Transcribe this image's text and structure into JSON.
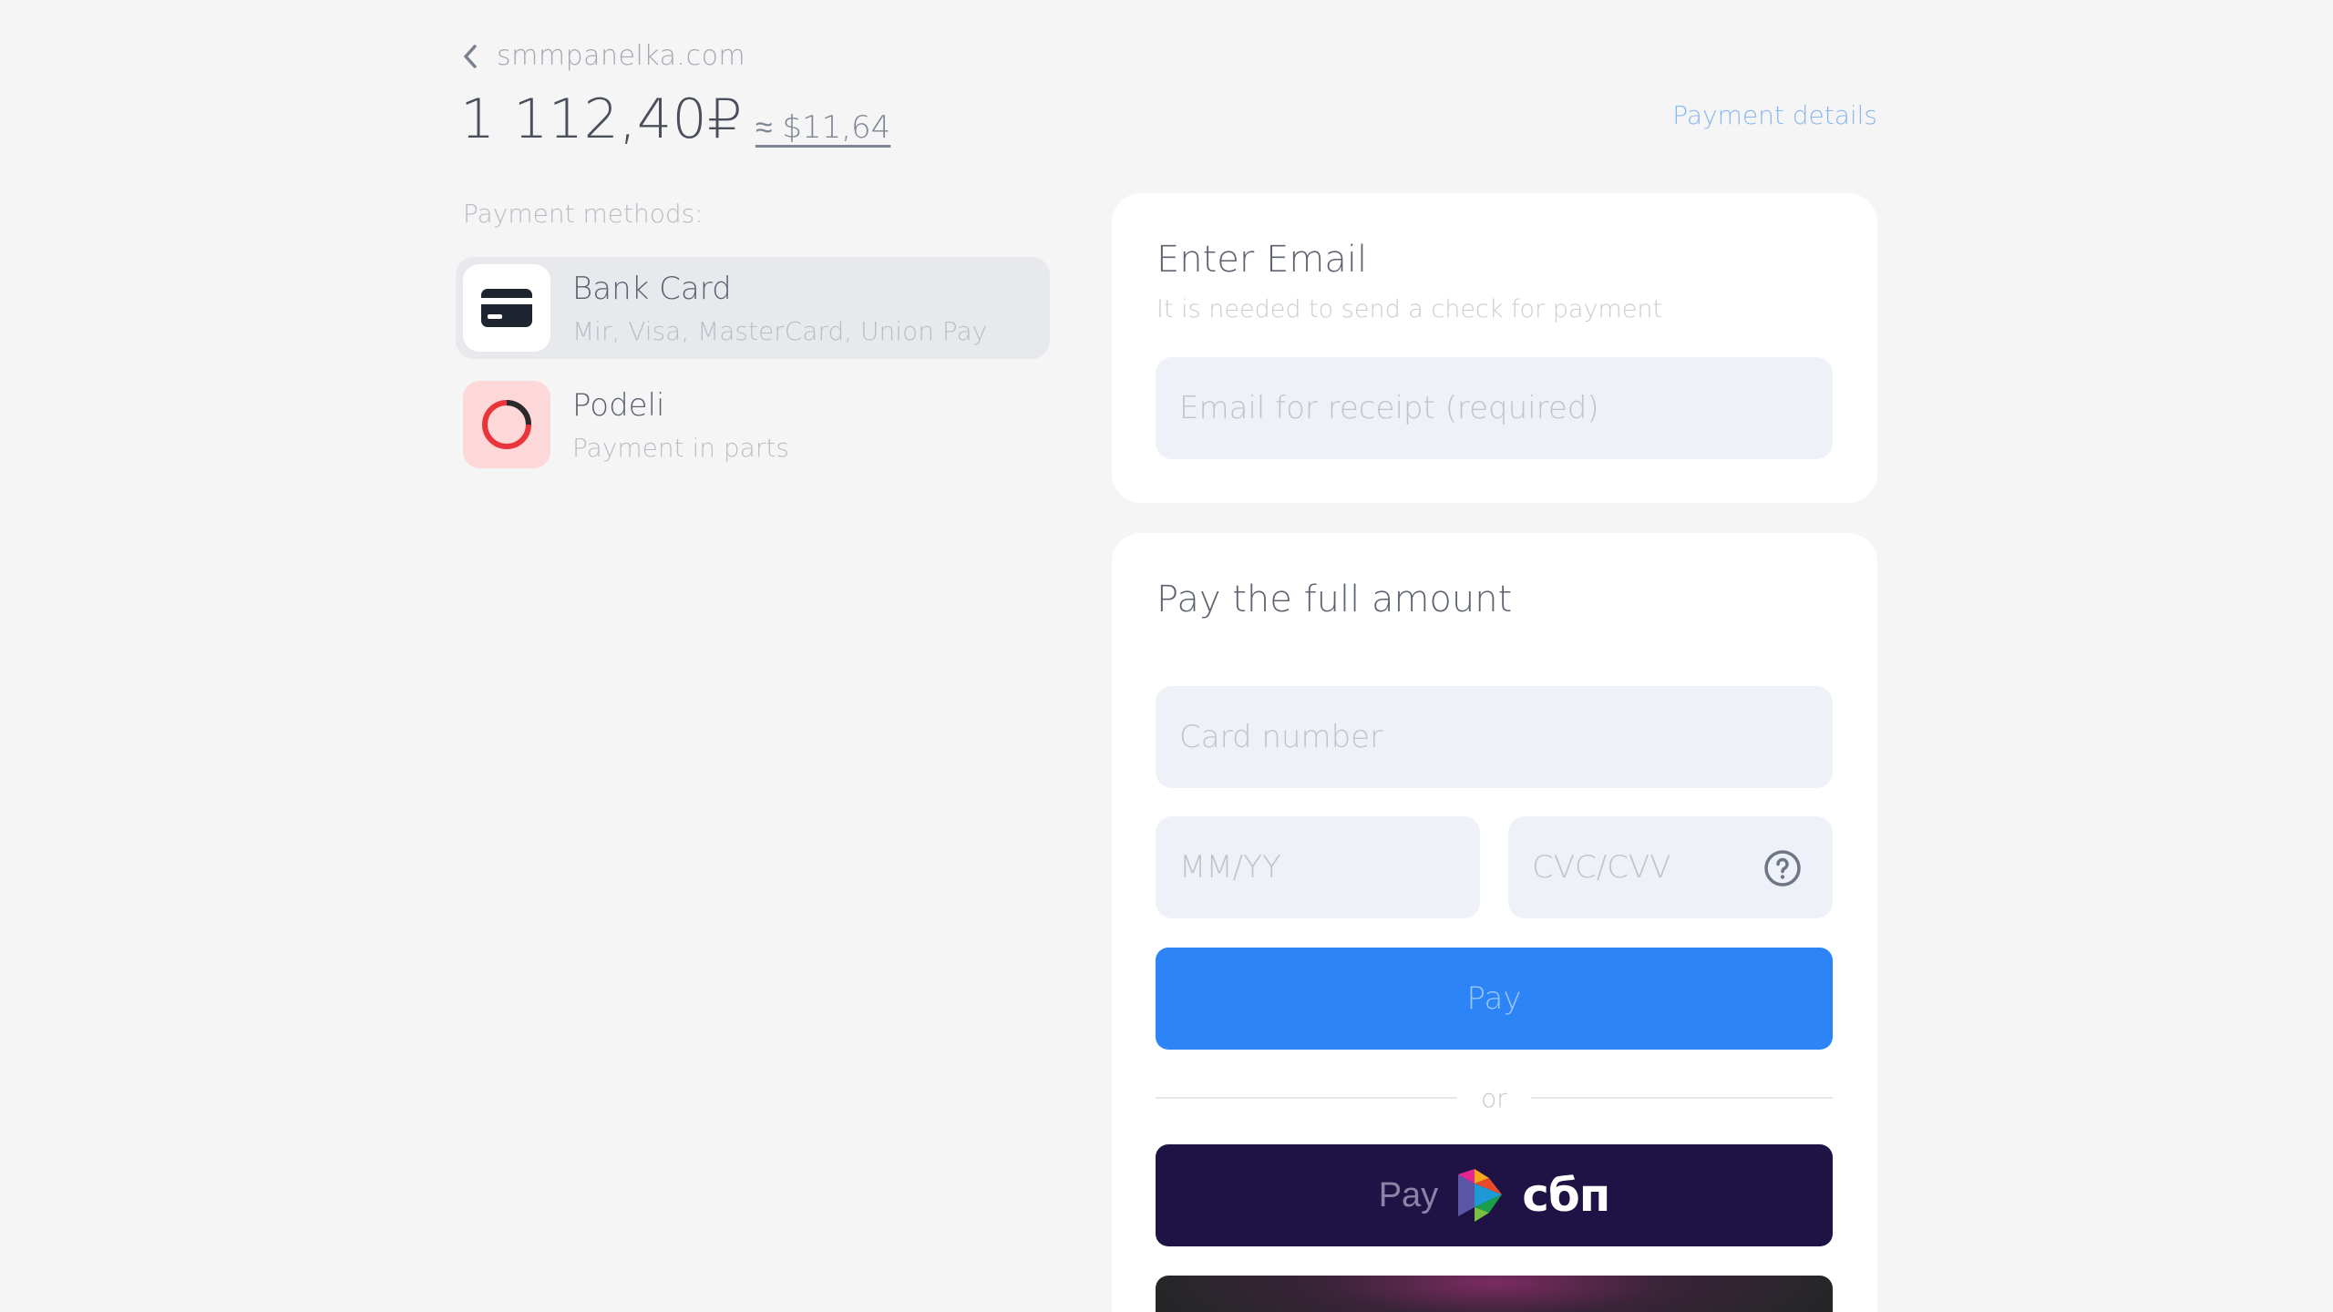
{
  "header": {
    "site": "smmpanelka.com",
    "amount": "1 112,40₽",
    "usd_approx": "≈ $11,64",
    "payment_details": "Payment details"
  },
  "methods": {
    "label": "Payment methods:",
    "items": [
      {
        "title": "Bank Card",
        "subtitle": "Mir, Visa, MasterCard, Union Pay",
        "icon": "credit-card-icon",
        "selected": true
      },
      {
        "title": "Podeli",
        "subtitle": "Payment in parts",
        "icon": "podeli-ring-icon",
        "selected": false
      }
    ]
  },
  "email_card": {
    "title": "Enter Email",
    "hint": "It is needed to send a check for payment",
    "placeholder": "Email for receipt (required)"
  },
  "pay_card": {
    "title": "Pay the full amount",
    "card_number_placeholder": "Card number",
    "expiry_placeholder": "MM/YY",
    "cvc_placeholder": "CVC/CVV",
    "pay_label": "Pay",
    "or_label": "or",
    "sbp_pay_label": "Pay",
    "sbp_brand": "сбп"
  },
  "colors": {
    "background": "#f5f5f5",
    "accent": "#2c84f7",
    "sbp": "#1f1244",
    "podeli": "#e8343a"
  }
}
